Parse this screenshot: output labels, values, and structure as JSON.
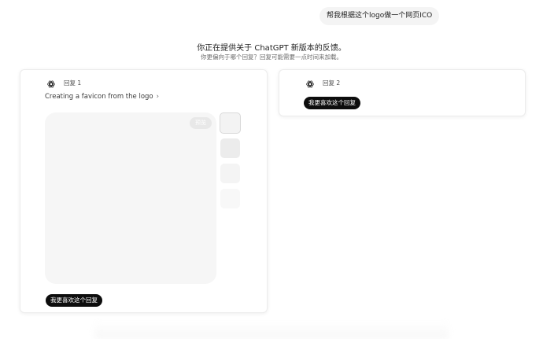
{
  "conversation": {
    "user_message": "帮我根据这个logo做一个网页ICO"
  },
  "feedback": {
    "title": "你正在提供关于 ChatGPT 新版本的反馈。",
    "subtitle": "你更偏向于哪个回复？回复可能需要一点时间来加载。"
  },
  "responses": [
    {
      "label": "回复 1",
      "icon": "openai-logo-icon",
      "task_text": "Creating a favicon from the logo",
      "task_chevron": "›",
      "preview_badge": "预览",
      "prefer_label": "我更喜欢这个回复"
    },
    {
      "label": "回复 2",
      "icon": "openai-logo-icon",
      "prefer_label": "我更喜欢这个回复"
    }
  ]
}
